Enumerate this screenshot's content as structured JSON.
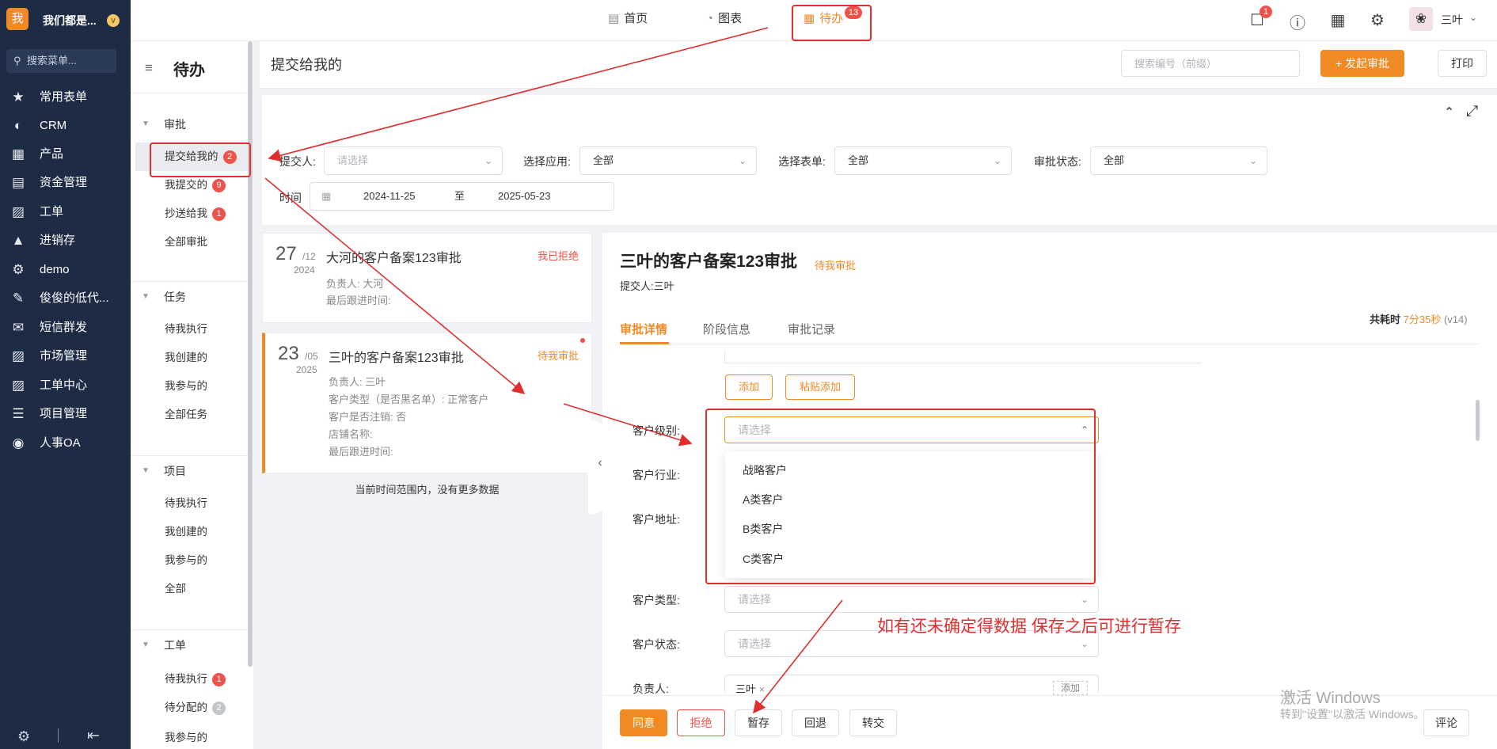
{
  "app": {
    "logo_char": "我",
    "name": "我们都是...",
    "badge": "v"
  },
  "leftnav": {
    "search_placeholder": "搜索菜单...",
    "items": [
      {
        "label": "常用表单",
        "icon": "star-icon"
      },
      {
        "label": "CRM",
        "icon": "crm-icon"
      },
      {
        "label": "产品",
        "icon": "product-icon"
      },
      {
        "label": "资金管理",
        "icon": "finance-icon"
      },
      {
        "label": "工单",
        "icon": "clipboard-icon"
      },
      {
        "label": "进销存",
        "icon": "inventory-icon"
      },
      {
        "label": "demo",
        "icon": "gear-circle-icon"
      },
      {
        "label": "俊俊的低代...",
        "icon": "edit-doc-icon"
      },
      {
        "label": "短信群发",
        "icon": "mail-icon"
      },
      {
        "label": "市场管理",
        "icon": "market-icon"
      },
      {
        "label": "工单中心",
        "icon": "clipboard-icon"
      },
      {
        "label": "项目管理",
        "icon": "layers-icon"
      },
      {
        "label": "人事OA",
        "icon": "globe-icon"
      }
    ]
  },
  "topbar": {
    "tabs": [
      {
        "label": "首页",
        "icon": "home-icon"
      },
      {
        "label": "图表",
        "icon": "chart-icon"
      },
      {
        "label": "待办",
        "icon": "calendar-icon"
      }
    ],
    "todo_badge": "13",
    "msg_badge": "1",
    "username": "三叶"
  },
  "subnav": {
    "title": "待办",
    "groups": [
      {
        "label": "审批",
        "items": [
          {
            "label": "提交给我的",
            "badge": "2"
          },
          {
            "label": "我提交的",
            "badge": "9"
          },
          {
            "label": "抄送给我",
            "badge": "1"
          },
          {
            "label": "全部审批",
            "badge": ""
          }
        ]
      },
      {
        "label": "任务",
        "items": [
          {
            "label": "待我执行",
            "badge": ""
          },
          {
            "label": "我创建的",
            "badge": ""
          },
          {
            "label": "我参与的",
            "badge": ""
          },
          {
            "label": "全部任务",
            "badge": ""
          }
        ]
      },
      {
        "label": "项目",
        "items": [
          {
            "label": "待我执行",
            "badge": ""
          },
          {
            "label": "我创建的",
            "badge": ""
          },
          {
            "label": "我参与的",
            "badge": ""
          },
          {
            "label": "全部",
            "badge": ""
          }
        ]
      },
      {
        "label": "工单",
        "items": [
          {
            "label": "待我执行",
            "badge": "1"
          },
          {
            "label": "待分配的",
            "badge": "2"
          },
          {
            "label": "我参与的",
            "badge": ""
          }
        ]
      }
    ]
  },
  "page": {
    "title": "提交给我的",
    "search_placeholder": "搜索编号（前缀）",
    "start_label": "+ 发起审批",
    "print_label": "打印"
  },
  "filters": {
    "submitter_label": "提交人:",
    "submitter_placeholder": "请选择",
    "app_label": "选择应用:",
    "app_value": "全部",
    "form_label": "选择表单:",
    "form_value": "全部",
    "status_label": "审批状态:",
    "status_value": "全部",
    "time_label": "时间",
    "date_start": "2024-11-25",
    "date_sep": "至",
    "date_end": "2025-05-23"
  },
  "list": {
    "cards": [
      {
        "day": "27",
        "month": "/12",
        "year": "2024",
        "title": "大河的客户备案123审批",
        "status": "我已拒绝",
        "lines": [
          "负责人: 大河",
          "最后跟进时间:"
        ]
      },
      {
        "day": "23",
        "month": "/05",
        "year": "2025",
        "title": "三叶的客户备案123审批",
        "status": "待我审批",
        "lines": [
          "负责人: 三叶",
          "客户类型（是否黑名单）: 正常客户",
          "客户是否注销: 否",
          "店铺名称:",
          "最后跟进时间:"
        ]
      }
    ],
    "no_more": "当前时间范围内，没有更多数据"
  },
  "detail": {
    "title": "三叶的客户备案123审批",
    "status": "待我审批",
    "submitter": "提交人:三叶",
    "time_label": "共耗时",
    "time_value": "7分35秒",
    "version": "(v14)",
    "tabs": [
      "审批详情",
      "阶段信息",
      "审批记录"
    ],
    "add_label": "添加",
    "paste_add_label": "粘贴添加",
    "fields": [
      {
        "label": "客户级别:",
        "placeholder": "请选择"
      },
      {
        "label": "客户行业:",
        "placeholder": ""
      },
      {
        "label": "客户地址:",
        "placeholder": ""
      },
      {
        "label": "客户类型:",
        "placeholder": "请选择"
      },
      {
        "label": "客户状态:",
        "placeholder": "请选择"
      },
      {
        "label": "负责人:",
        "placeholder": ""
      }
    ],
    "level_options": [
      "战略客户",
      "A类客户",
      "B类客户",
      "C类客户"
    ],
    "owner_tag": "三叶",
    "owner_add": "添加"
  },
  "actions": [
    "同意",
    "拒绝",
    "暂存",
    "回退",
    "转交",
    "评论"
  ],
  "watermark": {
    "line1": "激活 Windows",
    "line2": "转到\"设置\"以激活 Windows。"
  },
  "annotation": {
    "note": "如有还未确定得数据 保存之后可进行暂存",
    "color": "#e02d2d"
  },
  "colors": {
    "accent": "#f08a24",
    "danger": "#f0524a",
    "nav_bg": "#1d2b45"
  }
}
